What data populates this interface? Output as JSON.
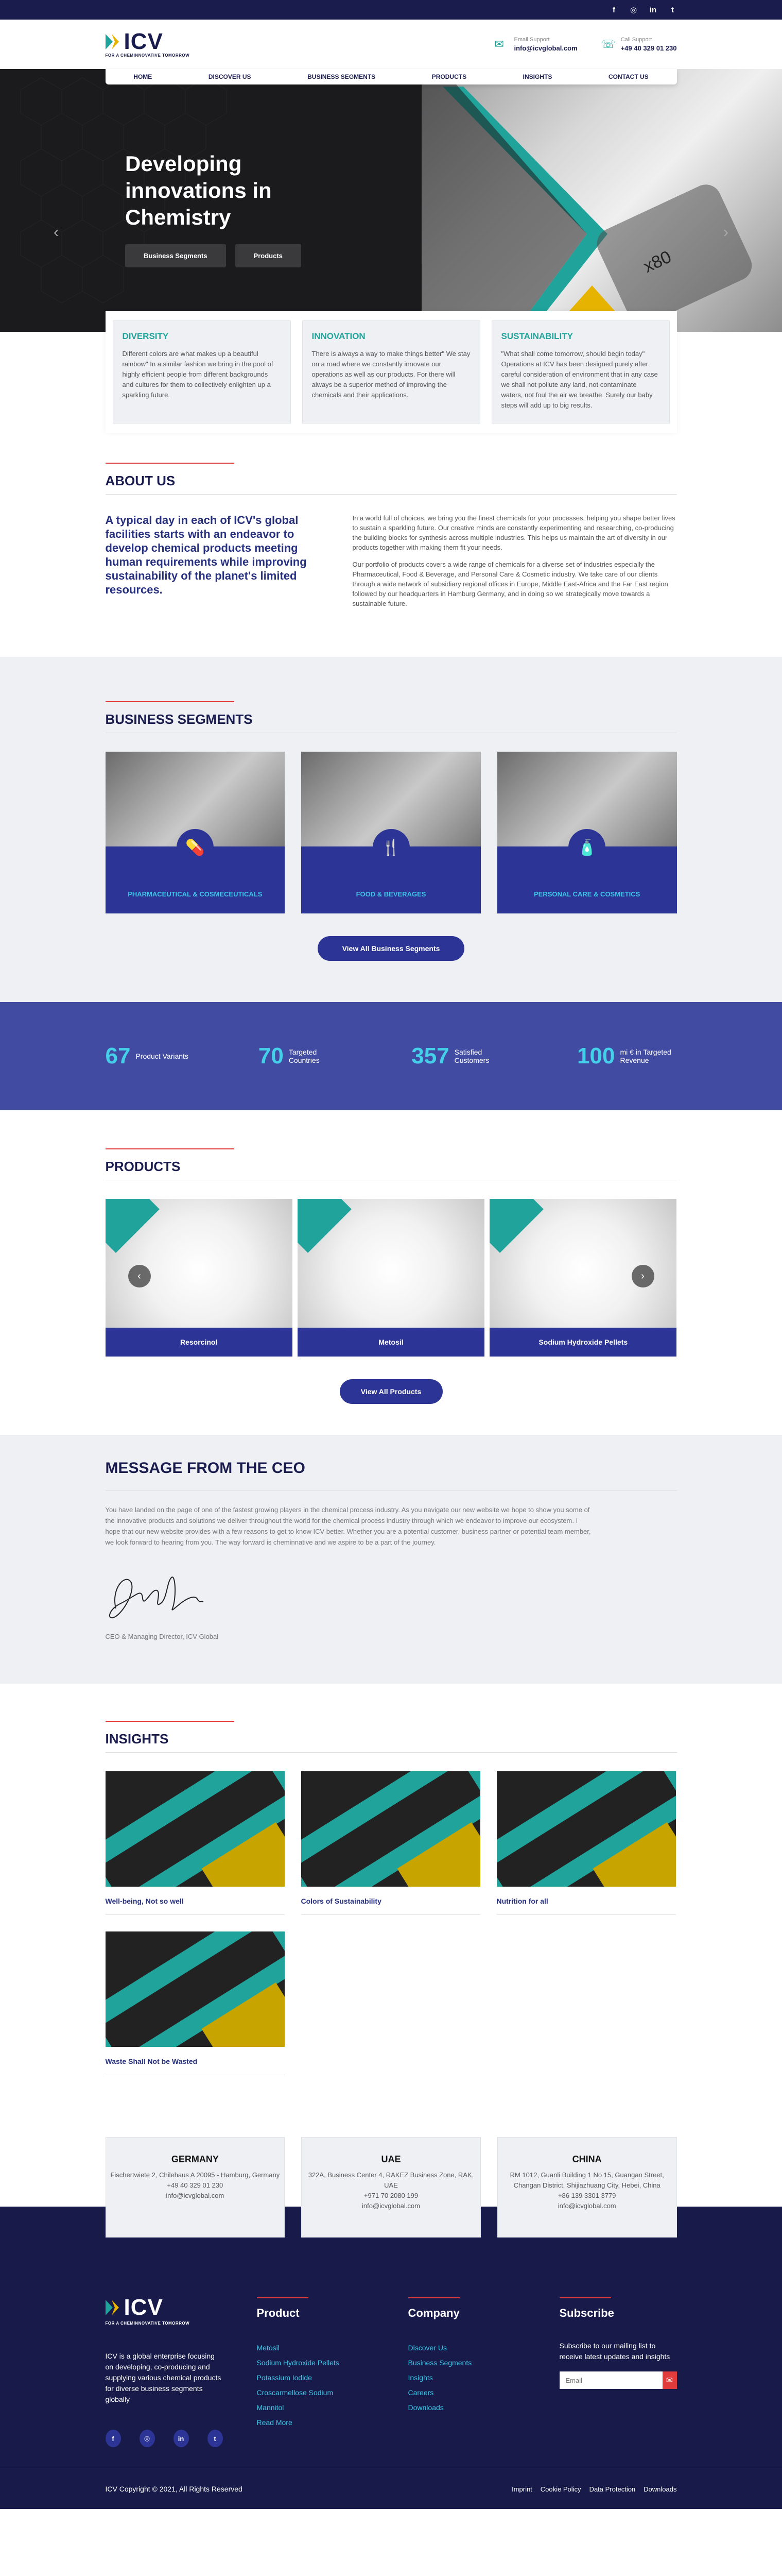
{
  "social": [
    "f",
    "◎",
    "in",
    "t"
  ],
  "brand": {
    "name": "ICV",
    "tagline": "FOR A CHEMINNOVATIVE TOMORROW"
  },
  "contacts": [
    {
      "label": "Email Support",
      "value": "info@icvglobal.com"
    },
    {
      "label": "Call Support",
      "value": "+49 40 329 01 230"
    }
  ],
  "nav": [
    "HOME",
    "DISCOVER US",
    "BUSINESS SEGMENTS",
    "PRODUCTS",
    "INSIGHTS",
    "CONTACT US"
  ],
  "hero": {
    "title": "Developing innovations in Chemistry",
    "buttons": [
      "Business Segments",
      "Products"
    ]
  },
  "pillars": [
    {
      "title": "DIVERSITY",
      "text": "Different colors are what makes up a beautiful rainbow\" In a similar fashion we bring in the pool of highly efficient people from different backgrounds and cultures for them to collectively enlighten up a sparkling future."
    },
    {
      "title": "INNOVATION",
      "text": "There is always a way to make things better\" We stay on a road where we constantly innovate our operations as well as our products. For there will always be a superior method of improving the chemicals and their applications."
    },
    {
      "title": "SUSTAINABILITY",
      "text": "\"What shall come tomorrow, should begin today\" Operations at ICV has been designed purely after careful consideration of environment that in any case we shall not pollute any land, not contaminate waters, not foul the air we breathe. Surely our baby steps will add up to big results."
    }
  ],
  "about": {
    "title": "ABOUT US",
    "lead": "A typical day in each of ICV's global facilities starts with an endeavor to develop chemical products meeting human requirements while improving sustainability of the planet's limited resources.",
    "p1": "In a world full of choices, we bring you the finest chemicals for your processes, helping you shape better lives to sustain a sparkling future. Our creative minds are constantly experimenting and researching, co-producing the building blocks for synthesis across multiple industries. This helps us maintain the art of diversity in our products together with making them fit your needs.",
    "p2": "Our portfolio of products covers a wide range of chemicals for a diverse set of industries especially the Pharmaceutical, Food & Beverage, and Personal Care & Cosmetic industry. We take care of our clients through a wide network of subsidiary regional offices in Europe, Middle East-Africa and the Far East region followed by our headquarters in Hamburg Germany, and in doing so we strategically move towards a sustainable future."
  },
  "segments": {
    "title": "BUSINESS SEGMENTS",
    "items": [
      {
        "label": "PHARMACEUTICAL & COSMECEUTICALS",
        "icon": "💊"
      },
      {
        "label": "FOOD & BEVERAGES",
        "icon": "🍴"
      },
      {
        "label": "PERSONAL CARE & COSMETICS",
        "icon": "🧴"
      }
    ],
    "button": "View All Business Segments"
  },
  "stats": [
    {
      "value": "67",
      "label": "Product Variants"
    },
    {
      "value": "70",
      "label": "Targeted Countries"
    },
    {
      "value": "357",
      "label": "Satisfied Customers"
    },
    {
      "value": "100",
      "label": "mi € in Targeted Revenue"
    }
  ],
  "products": {
    "title": "PRODUCTS",
    "items": [
      "Resorcinol",
      "Metosil",
      "Sodium Hydroxide Pellets"
    ],
    "button": "View All Products"
  },
  "ceo": {
    "title": "MESSAGE FROM THE CEO",
    "text": "You have landed on the page of one of the fastest growing players in the chemical process industry. As you navigate our new website we hope to show you some of the innovative products and solutions we deliver throughout the world for the chemical process industry through which we endeavor to improve our ecosystem. I hope that our new website provides with a few reasons to get to know ICV better. Whether you are a potential customer, business partner or potential team member, we look forward to hearing from you. The way forward is cheminnative and we aspire to be a part of the journey.",
    "role": "CEO & Managing Director, ICV Global"
  },
  "insights": {
    "title": "INSIGHTS",
    "items": [
      "Well-being, Not so well",
      "Colors of Sustainability",
      "Nutrition for all",
      "Waste Shall Not be Wasted"
    ]
  },
  "offices": [
    {
      "country": "GERMANY",
      "address": "Fischertwiete 2, Chilehaus A 20095 - Hamburg, Germany",
      "phone": "+49 40 329 01 230",
      "email": "info@icvglobal.com"
    },
    {
      "country": "UAE",
      "address": "322A, Business Center 4, RAKEZ Business Zone, RAK, UAE",
      "phone": "+971 70 2080 199",
      "email": "info@icvglobal.com"
    },
    {
      "country": "CHINA",
      "address": "RM 1012, Guanli Building 1 No 15, Guangan Street, Changan District, Shijiazhuang City, Hebei, China",
      "phone": "+86 139 3301 3779",
      "email": "info@icvglobal.com"
    }
  ],
  "footer": {
    "about": "ICV is a global enterprise focusing on developing, co-producing and supplying various chemical products for diverse business segments globally",
    "product_title": "Product",
    "products": [
      "Metosil",
      "Sodium Hydroxide Pellets",
      "Potassium Iodide",
      "Croscarmellose Sodium",
      "Mannitol",
      "Read More"
    ],
    "company_title": "Company",
    "company": [
      "Discover Us",
      "Business Segments",
      "Insights",
      "Careers",
      "Downloads"
    ],
    "subscribe_title": "Subscribe",
    "subscribe_text": "Subscribe to our mailing list to receive latest updates and insights",
    "email_placeholder": "Email",
    "copyright": "ICV Copyright © 2021, All Rights Reserved",
    "legal": [
      "Imprint",
      "Cookie Policy",
      "Data Protection",
      "Downloads"
    ]
  },
  "colors": {
    "navy": "#1a1c4e",
    "blue": "#2c3595",
    "teal": "#1fa39a",
    "cyan": "#3cc5e6",
    "red": "#e23b3b",
    "stats_bg": "#424ba2"
  }
}
